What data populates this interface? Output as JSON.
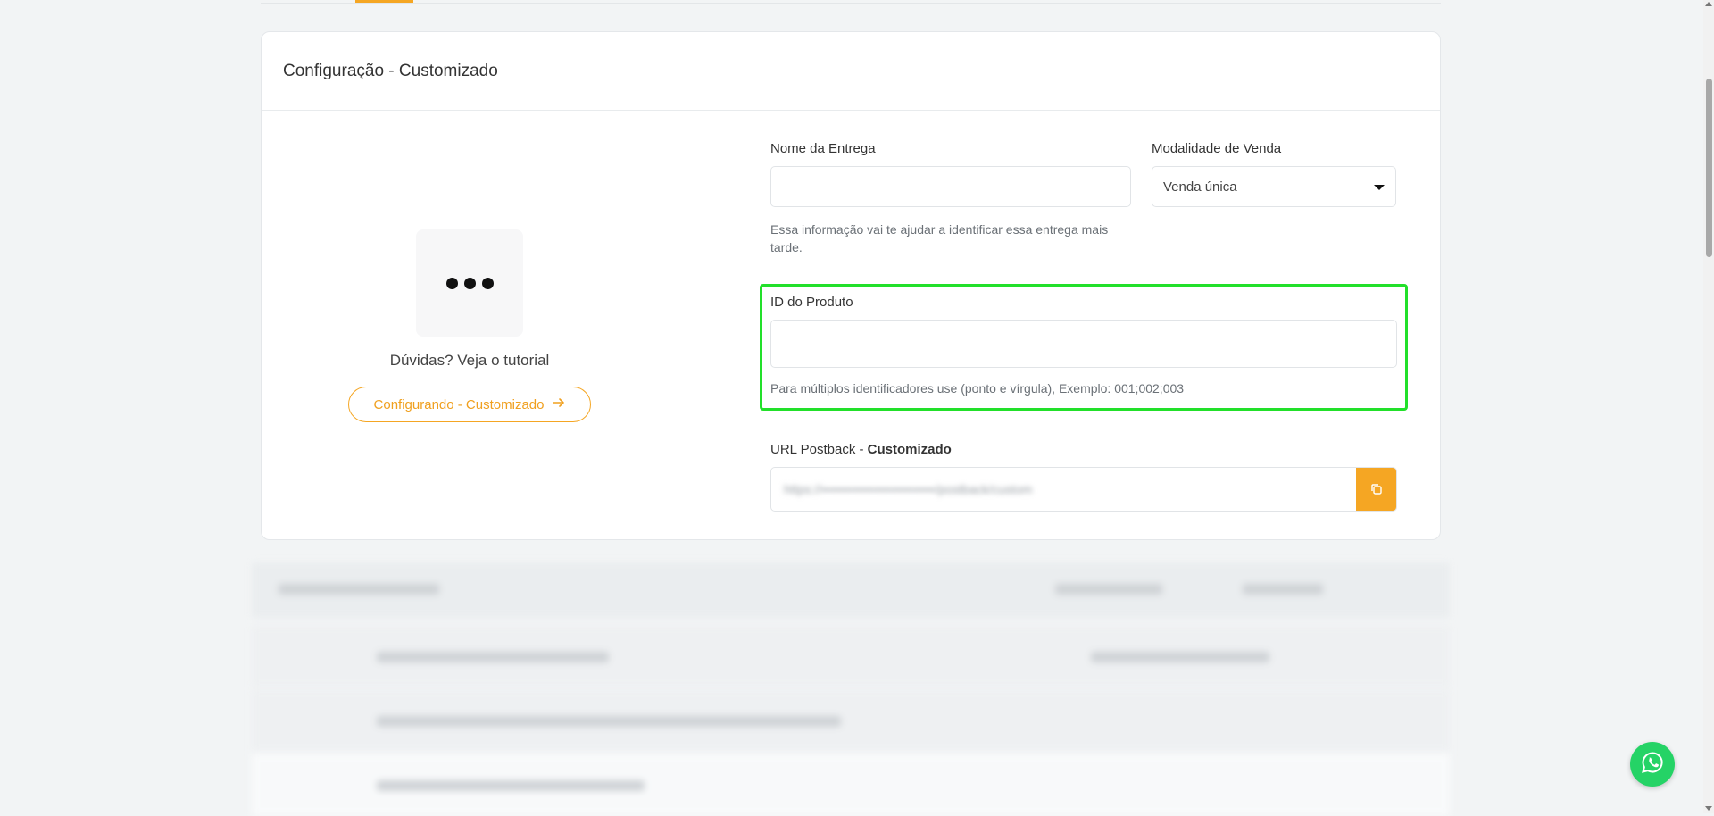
{
  "card": {
    "title": "Configuração - Customizado"
  },
  "tutorial": {
    "text": "Dúvidas? Veja o tutorial",
    "button_label": "Configurando - Customizado",
    "thumb_icon": "ellipsis-icon"
  },
  "form": {
    "delivery_name": {
      "label": "Nome da Entrega",
      "value": "",
      "help": "Essa informação vai te ajudar a identificar essa entrega mais tarde."
    },
    "sale_mode": {
      "label": "Modalidade de Venda",
      "selected": "Venda única"
    },
    "product_id": {
      "label": "ID do Produto",
      "value": "",
      "help": "Para múltiplos identificadores use (ponto e vírgula), Exemplo: 001;002;003"
    },
    "postback": {
      "label_prefix": "URL Postback - ",
      "label_bold": "Customizado",
      "url": "https://••••••••••••••••••••••••••/postback/custom"
    }
  },
  "colors": {
    "accent": "#f5a623",
    "highlight": "#22e02a",
    "whatsapp": "#25d366"
  },
  "icons": {
    "copy": "copy-icon",
    "arrow": "arrow-right-icon",
    "whatsapp": "whatsapp-icon"
  }
}
